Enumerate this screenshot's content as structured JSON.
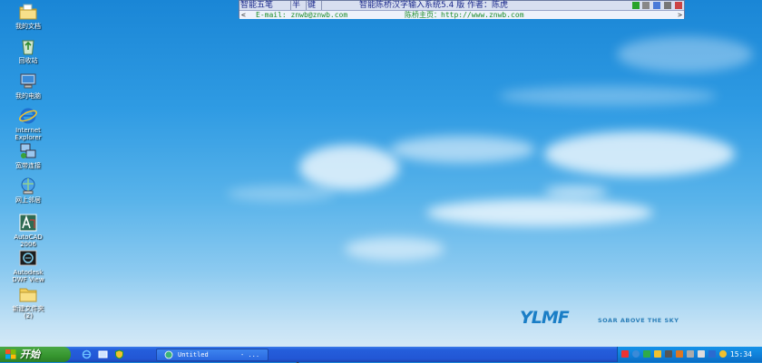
{
  "desktop_icons": [
    {
      "name": "my-documents",
      "label": "我的文档",
      "icon": "folder-documents-icon"
    },
    {
      "name": "recycle-bin",
      "label": "回收站",
      "icon": "recycle-bin-icon"
    },
    {
      "name": "my-computer",
      "label": "我的电脑",
      "icon": "computer-icon"
    },
    {
      "name": "internet-explorer",
      "label": "Internet\nExplorer",
      "icon": "ie-icon"
    },
    {
      "name": "broadband-connection",
      "label": "宽带连接",
      "icon": "network-icon"
    },
    {
      "name": "network-places",
      "label": "网上邻居",
      "icon": "network-places-icon"
    },
    {
      "name": "autocad",
      "label": "AutoCAD\n2006",
      "icon": "autocad-icon"
    },
    {
      "name": "autodesk-dwf-viewer",
      "label": "Autodesk\nDWF View",
      "icon": "dwf-viewer-icon"
    },
    {
      "name": "new-folder",
      "label": "新建文件夹\n(2)",
      "icon": "folder-icon"
    }
  ],
  "ime": {
    "mode_cells": [
      "智能五笔",
      "半",
      "键"
    ],
    "title": "智能陈桥汉字输入系统5.4 版    作者：陈虎",
    "email": "E-mail: znwb@znwb.com",
    "homepage": "陈桥主页：http://www.znwb.com",
    "left_arrow": "<",
    "right_arrow": ">"
  },
  "wallpaper": {
    "logo": "YLMF",
    "slogan": "SOAR ABOVE THE SKY"
  },
  "taskbar": {
    "start_label": "开始",
    "task_label": "Untitled",
    "task_suffix": "- ...",
    "clock": "15:34"
  },
  "colors": {
    "taskbar": "#245edc",
    "start_button": "#36962f",
    "tray": "#0f7fd8",
    "ime_bar": "#d8dff0"
  }
}
